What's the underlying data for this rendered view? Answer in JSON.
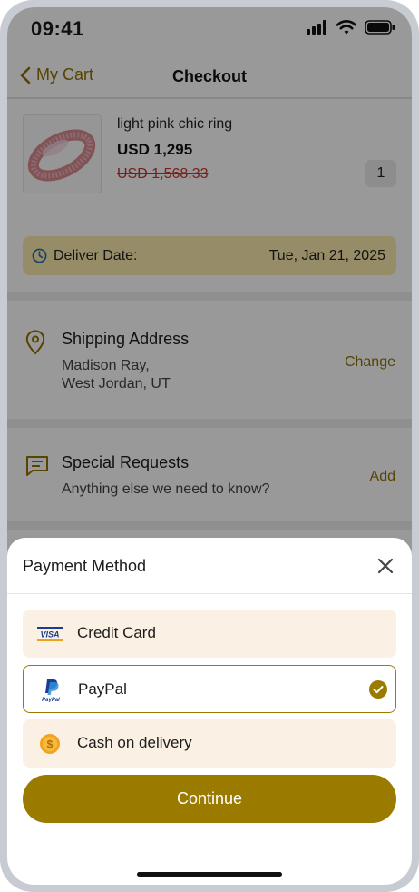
{
  "status_bar": {
    "time": "09:41",
    "icons": [
      "signal-icon",
      "wifi-icon",
      "battery-icon"
    ]
  },
  "nav": {
    "back_label": "My Cart",
    "title": "Checkout"
  },
  "product": {
    "name": "light pink chic ring",
    "price": "USD 1,295",
    "old_price": "USD 1,568.33",
    "quantity": "1"
  },
  "delivery": {
    "label": "Deliver Date:",
    "date": "Tue, Jan 21, 2025"
  },
  "shipping": {
    "title": "Shipping Address",
    "name": "Madison Ray,",
    "city": "West Jordan, UT",
    "action": "Change"
  },
  "special_requests": {
    "title": "Special Requests",
    "subtitle": "Anything else we need to know?",
    "action": "Add"
  },
  "payment_sheet": {
    "title": "Payment Method",
    "options": [
      {
        "label": "Credit Card",
        "icon": "visa-icon",
        "selected": false
      },
      {
        "label": "PayPal",
        "icon": "paypal-icon",
        "selected": true
      },
      {
        "label": "Cash on delivery",
        "icon": "coin-icon",
        "selected": false
      }
    ],
    "continue_label": "Continue"
  },
  "colors": {
    "accent": "#9a7b00",
    "accent_text": "#8f7200",
    "delivery_bg": "#fbe9ac",
    "option_bg": "#fbf0e4",
    "old_price": "#c7382f"
  }
}
